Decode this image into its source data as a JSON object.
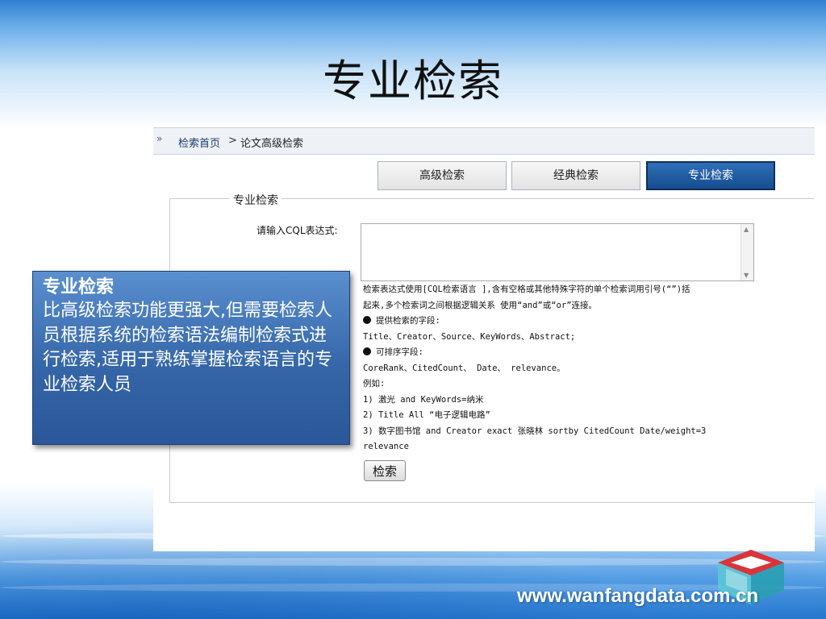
{
  "slide": {
    "title": "专业检索",
    "footer_url": "www.wanfangdata.com.cn"
  },
  "breadcrumb": {
    "arrows": "»",
    "home": "检索首页",
    "separator": ">",
    "current": "论文高级检索"
  },
  "tabs": [
    {
      "label": "高级检索",
      "active": false
    },
    {
      "label": "经典检索",
      "active": false
    },
    {
      "label": "专业检索",
      "active": true
    }
  ],
  "form": {
    "legend": "专业检索",
    "cql_label": "请输入CQL表达式:",
    "cql_value": "",
    "help_lines": [
      "检索表达式使用[CQL检索语言 ],含有空格或其他特殊字符的单个检索词用引号(“”)括",
      "起来,多个检索词之间根据逻辑关系 使用“and”或“or”连接。",
      "提供检索的字段:",
      "Title、Creator、Source、KeyWords、Abstract;",
      "可排序字段:",
      "CoreRank、CitedCount、 Date、 relevance。",
      "例如:",
      "1) 激光 and KeyWords=纳米",
      "2) Title All “电子逻辑电路”",
      "3) 数字图书馆 and Creator exact 张晓林 sortby CitedCount Date/weight=3",
      "relevance"
    ],
    "search_button": "检索"
  },
  "callout": {
    "title": "专业检索",
    "body": "比高级检索功能更强大,但需要检索人员根据系统的检索语法编制检索式进行检索,适用于熟练掌握检索语言的专业检索人员"
  },
  "colors": {
    "accent": "#1a4f93",
    "callout": "#3566a8",
    "logo_red": "#d9343a",
    "logo_teal": "#3bb3c3"
  }
}
